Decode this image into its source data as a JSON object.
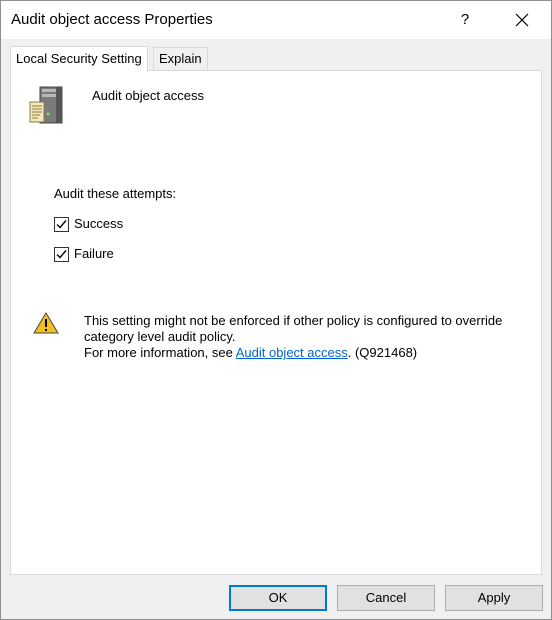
{
  "window": {
    "title": "Audit object access Properties",
    "help_label": "?"
  },
  "tabs": [
    {
      "label": "Local Security Setting",
      "active": true
    },
    {
      "label": "Explain",
      "active": false
    }
  ],
  "panel": {
    "policy_name": "Audit object access",
    "attempts_label": "Audit these attempts:",
    "checkboxes": [
      {
        "label": "Success",
        "checked": true
      },
      {
        "label": "Failure",
        "checked": true
      }
    ],
    "warning": {
      "line1": "This setting might not be enforced if other policy is configured to override",
      "line2": "category level audit policy.",
      "line3_prefix": "For more information, see ",
      "link_text": "Audit object access",
      "line3_suffix": ". (Q921468)"
    }
  },
  "buttons": {
    "ok": "OK",
    "cancel": "Cancel",
    "apply": "Apply"
  },
  "colors": {
    "link": "#0066cc",
    "default_button_border": "#0078d7",
    "warning_yellow": "#f4c020"
  }
}
